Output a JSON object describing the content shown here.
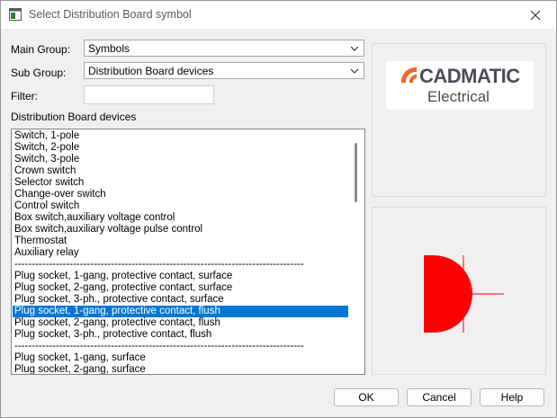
{
  "window": {
    "title": "Select Distribution Board symbol"
  },
  "form": {
    "main_group_label": "Main Group:",
    "main_group_value": "Symbols",
    "sub_group_label": "Sub Group:",
    "sub_group_value": "Distribution Board devices",
    "filter_label": "Filter:",
    "filter_value": "",
    "list_label": "Distribution Board devices"
  },
  "list": {
    "items": [
      "Switch, 1-pole",
      "Switch, 2-pole",
      "Switch, 3-pole",
      "Crown switch",
      "Selector switch",
      "Change-over switch",
      "Control switch",
      "Box switch,auxiliary voltage control",
      "Box switch,auxiliary voltage pulse control",
      "Thermostat",
      "Auxiliary relay",
      "------------------------------------------------------------------------------------",
      "Plug socket, 1-gang, protective contact, surface",
      "Plug socket, 2-gang, protective contact, surface",
      "Plug socket, 3-ph., protective contact, surface",
      "Plug socket, 1-gang, protective contact, flush",
      "Plug socket, 2-gang, protective contact, flush",
      "Plug socket, 3-ph., protective contact, flush",
      "------------------------------------------------------------------------------------",
      "Plug socket, 1-gang, surface",
      "Plug socket, 2-gang, surface"
    ],
    "selected_index": 15
  },
  "logo": {
    "brand": "CADMATIC",
    "product": "Electrical",
    "brand_color": "#f26522"
  },
  "preview": {
    "symbol_color": "#ff0000"
  },
  "buttons": {
    "ok": "OK",
    "cancel": "Cancel",
    "help": "Help"
  }
}
